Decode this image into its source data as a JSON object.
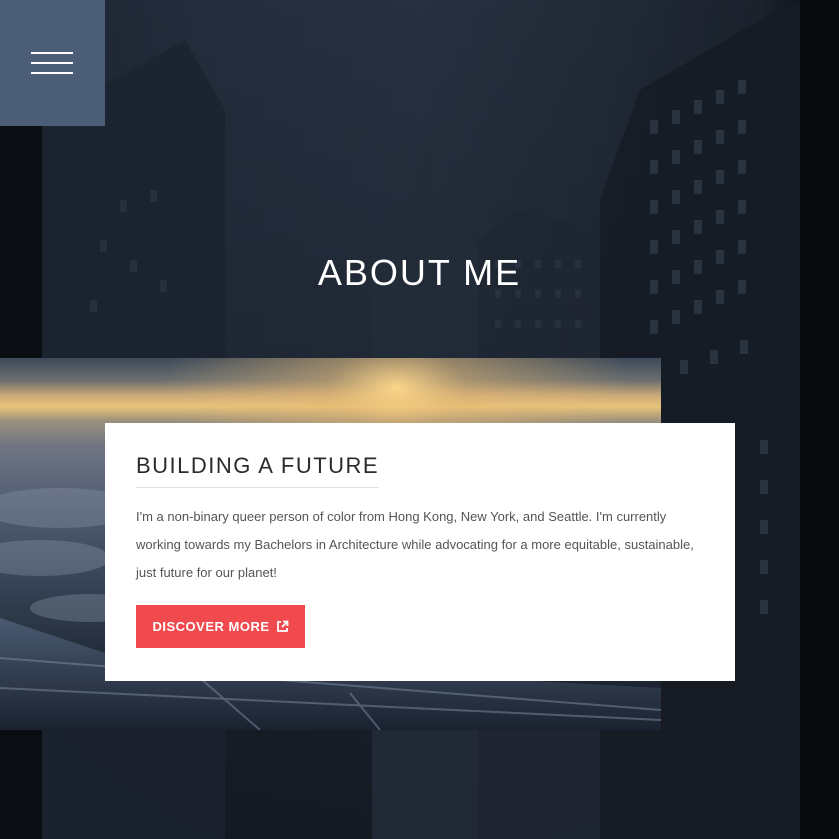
{
  "menu": {
    "icon": "hamburger-icon"
  },
  "hero": {
    "title": "ABOUT ME"
  },
  "card": {
    "title": "BUILDING A FUTURE",
    "body": "I'm a non-binary queer person of color from Hong Kong, New York, and Seattle. I'm currently working towards my Bachelors in Architecture while advocating for a more equitable, sustainable, just future for our planet!",
    "button_label": "DISCOVER MORE",
    "button_icon": "external-link-icon"
  },
  "colors": {
    "menu_bg": "#4c5d78",
    "accent": "#f04a4f",
    "card_bg": "#ffffff",
    "title_text": "#ffffff"
  }
}
